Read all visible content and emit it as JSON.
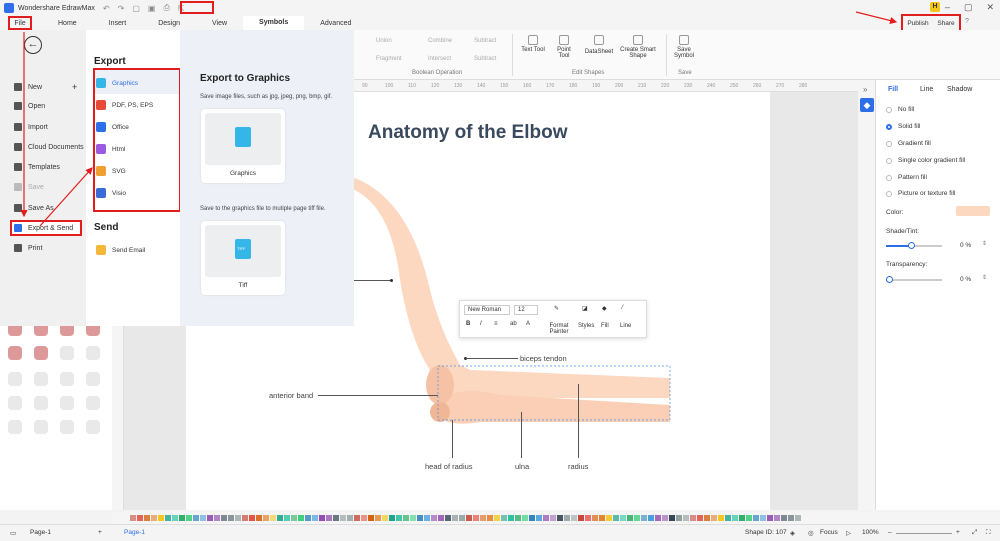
{
  "app": {
    "title": "Wondershare EdrawMax"
  },
  "tabs": [
    "Home",
    "Insert",
    "Design",
    "View",
    "Symbols",
    "Advanced"
  ],
  "active_tab": "Symbols",
  "file_tab": "File",
  "publish": "Publish",
  "share": "Share",
  "ribbon": {
    "union": "Union",
    "combine": "Combine",
    "subtract": "Subtract",
    "fragment": "Fragment",
    "intersect": "Intersect",
    "subtract2": "Subtract",
    "boolean_group": "Boolean Operation",
    "text_tool": "Text Tool",
    "point_tool": "Point Tool",
    "datasheet": "DataSheet",
    "smart_shape": "Create Smart Shape",
    "edit_group": "Edit Shapes",
    "save_symbol": "Save Symbol",
    "save_group": "Save"
  },
  "file_menu": {
    "new": "New",
    "open": "Open",
    "import": "Import",
    "cloud": "Cloud Documents",
    "templates": "Templates",
    "save": "Save",
    "save_as": "Save As",
    "export_send": "Export & Send",
    "print": "Print"
  },
  "export": {
    "heading": "Export",
    "items": [
      "Graphics",
      "PDF, PS, EPS",
      "Office",
      "Html",
      "SVG",
      "Visio"
    ],
    "send_heading": "Send",
    "send_email": "Send Email"
  },
  "export_to_graphics": {
    "title": "Export to Graphics",
    "desc1": "Save image files, such as jpg, jpeg, png, bmp, gif.",
    "card1": "Graphics",
    "desc2": "Save to the graphics file to mutiple page tiff file.",
    "card2": "Tiff",
    "tiff_badge": "TIFF"
  },
  "ruler": [
    "90",
    "100",
    "110",
    "120",
    "130",
    "140",
    "150",
    "160",
    "170",
    "180",
    "190",
    "200",
    "210",
    "220",
    "230",
    "240",
    "250",
    "260",
    "270",
    "280"
  ],
  "diagram": {
    "title": "Anatomy of the Elbow",
    "labels": {
      "biceps": "biceps tendon",
      "anterior": "anterior band",
      "head": "head of radius",
      "ulna": "ulna",
      "radius": "radius"
    }
  },
  "float_toolbar": {
    "font": "New Roman",
    "size": "12",
    "format_painter": "Format Painter",
    "styles": "Styles",
    "fill": "Fill",
    "line": "Line"
  },
  "right_panel": {
    "tabs": [
      "Fill",
      "Line",
      "Shadow"
    ],
    "options": [
      "No fill",
      "Solid fill",
      "Gradient fill",
      "Single color gradient fill",
      "Pattern fill",
      "Picture or texture fill"
    ],
    "selected": "Solid fill",
    "color_label": "Color:",
    "fill_color": "#fcd8c0",
    "shade_label": "Shade/Tint:",
    "shade_value": "0 %",
    "shade_fraction": 0.45,
    "transparency_label": "Transparency:",
    "transparency_value": "0 %",
    "transparency_fraction": 0.0
  },
  "status": {
    "page_left": "Page-1",
    "page_tab": "Page-1",
    "shape_id": "Shape ID: 107",
    "focus": "Focus",
    "zoom": "100%"
  },
  "colors": {
    "accent": "#2d6fe8",
    "annotation": "#e21d1d",
    "skin": "#fcd8c0",
    "title": "#3a4a5e"
  }
}
